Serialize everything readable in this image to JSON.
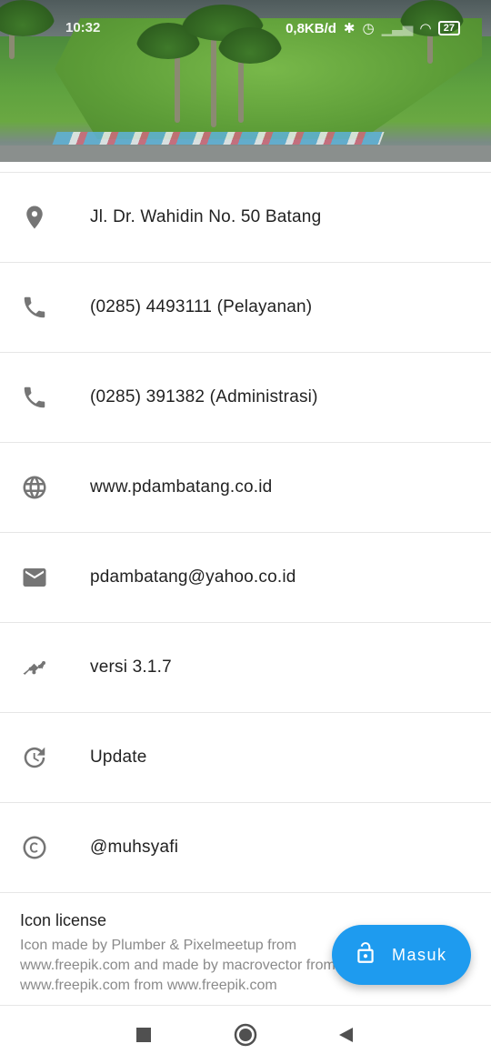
{
  "status_bar": {
    "time": "10:32",
    "network_speed": "0,8KB/d",
    "battery": "27",
    "icons": [
      "bluetooth-icon",
      "alarm-icon",
      "signal-icon",
      "wifi-icon",
      "battery-icon"
    ]
  },
  "contacts": [
    {
      "icon": "location-pin-icon",
      "text": "Jl. Dr. Wahidin No. 50 Batang"
    },
    {
      "icon": "phone-icon",
      "text": "(0285) 4493111 (Pelayanan)"
    },
    {
      "icon": "phone-icon",
      "text": "(0285) 391382 (Administrasi)"
    },
    {
      "icon": "globe-icon",
      "text": "www.pdambatang.co.id"
    },
    {
      "icon": "mail-icon",
      "text": "pdambatang@yahoo.co.id"
    },
    {
      "icon": "trending-icon",
      "text": "versi 3.1.7"
    },
    {
      "icon": "update-icon",
      "text": "Update"
    },
    {
      "icon": "copyright-icon",
      "text": "@muhsyafi"
    }
  ],
  "license": {
    "title": "Icon license",
    "body": "Icon made by Plumber & Pixelmeetup from www.freepik.com and made by macrovector from www.freepik.com from www.freepik.com"
  },
  "fab": {
    "label": "Masuk",
    "icon": "lock-open-icon"
  },
  "nav_bar": {
    "icons": [
      "recent-apps-icon",
      "home-icon",
      "back-icon"
    ]
  },
  "colors": {
    "accent": "#1e9bef",
    "icon_grey": "#757575",
    "divider": "#e6e6e6"
  }
}
